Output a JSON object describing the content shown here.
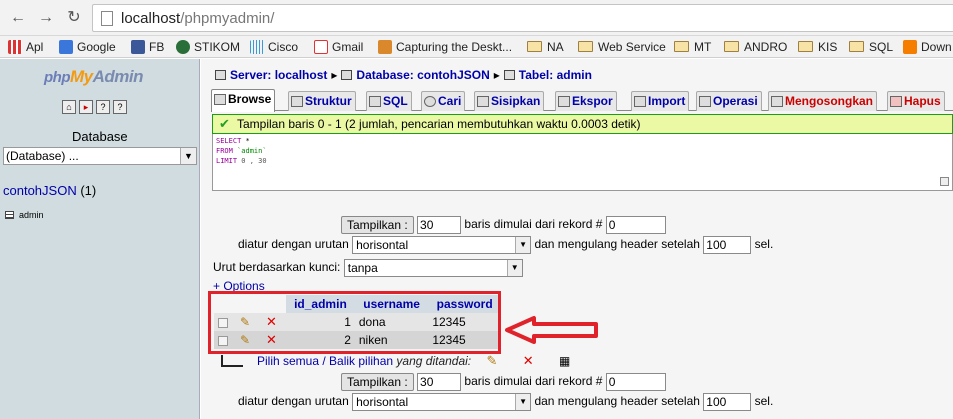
{
  "browser": {
    "url_host": "localhost",
    "url_path": "/phpmyadmin/",
    "bookmarks": [
      {
        "label": "Apl",
        "icon": "apps-grid-icon"
      },
      {
        "label": "Google",
        "icon": "google-icon"
      },
      {
        "label": "FB",
        "icon": "facebook-icon"
      },
      {
        "label": "STIKOM",
        "icon": "stikom-icon"
      },
      {
        "label": "Cisco",
        "icon": "cisco-icon"
      },
      {
        "label": "Gmail",
        "icon": "gmail-icon"
      },
      {
        "label": "Capturing the Deskt...",
        "icon": "capture-icon"
      },
      {
        "label": "NA",
        "icon": "folder-icon"
      },
      {
        "label": "Web Service",
        "icon": "folder-icon"
      },
      {
        "label": "MT",
        "icon": "folder-icon"
      },
      {
        "label": "ANDRO",
        "icon": "folder-icon"
      },
      {
        "label": "KIS",
        "icon": "folder-icon"
      },
      {
        "label": "SQL",
        "icon": "folder-icon"
      },
      {
        "label": "Down",
        "icon": "blogger-icon"
      }
    ]
  },
  "sidebar": {
    "logo_php": "php",
    "logo_my": "My",
    "logo_admin": "Admin",
    "database_label": "Database",
    "database_select": "(Database) ...",
    "db_name": "contohJSON",
    "db_count": "(1)",
    "table_item": "admin"
  },
  "header": {
    "server_label": "Server: localhost",
    "database_label": "Database: contohJSON",
    "table_label": "Tabel: admin"
  },
  "tabs": [
    {
      "label": "Browse"
    },
    {
      "label": "Struktur"
    },
    {
      "label": "SQL"
    },
    {
      "label": "Cari"
    },
    {
      "label": "Sisipkan"
    },
    {
      "label": "Ekspor"
    },
    {
      "label": "Import"
    },
    {
      "label": "Operasi"
    },
    {
      "label": "Mengosongkan"
    },
    {
      "label": "Hapus"
    }
  ],
  "notice": "Tampilan baris 0 - 1 (2 jumlah, pencarian membutuhkan waktu 0.0003 detik)",
  "sql": {
    "select_kw": "SELECT",
    "select_rest": " *",
    "from_kw": "FROM",
    "from_table": " `admin`",
    "limit_kw": "LIMIT",
    "limit_rest": " 0 , 30"
  },
  "nav_top": {
    "show_button": "Tampilkan :",
    "rows_value": "30",
    "rows_from_text": "baris dimulai dari rekord #",
    "start_value": "0",
    "order_text": "diatur dengan urutan",
    "order_value": "horisontal",
    "repeat_text": "dan mengulang header setelah",
    "repeat_value": "100",
    "cells_text": "sel.",
    "sort_label": "Urut berdasarkan kunci:",
    "sort_value": "tanpa",
    "options_link": "+ Options"
  },
  "table": {
    "columns": [
      "id_admin",
      "username",
      "password"
    ],
    "rows": [
      {
        "id_admin": "1",
        "username": "dona",
        "password": "12345"
      },
      {
        "id_admin": "2",
        "username": "niken",
        "password": "12345"
      }
    ]
  },
  "check_all": {
    "link": "Pilih semua / Balik pilihan",
    "italic": " yang ditandai:"
  },
  "nav_bottom": {
    "show_button": "Tampilkan :",
    "rows_value": "30",
    "rows_from_text": "baris dimulai dari rekord #",
    "start_value": "0",
    "order_text": "diatur dengan urutan",
    "order_value": "horisontal",
    "repeat_text": "dan mengulang header setelah",
    "repeat_value": "100",
    "cells_text": "sel."
  },
  "colors": {
    "annotation_red": "#e0232b",
    "notice_bg": "#ebf8a4",
    "link_blue": "#0000aa",
    "sidebar_bg": "#d0dce0"
  }
}
